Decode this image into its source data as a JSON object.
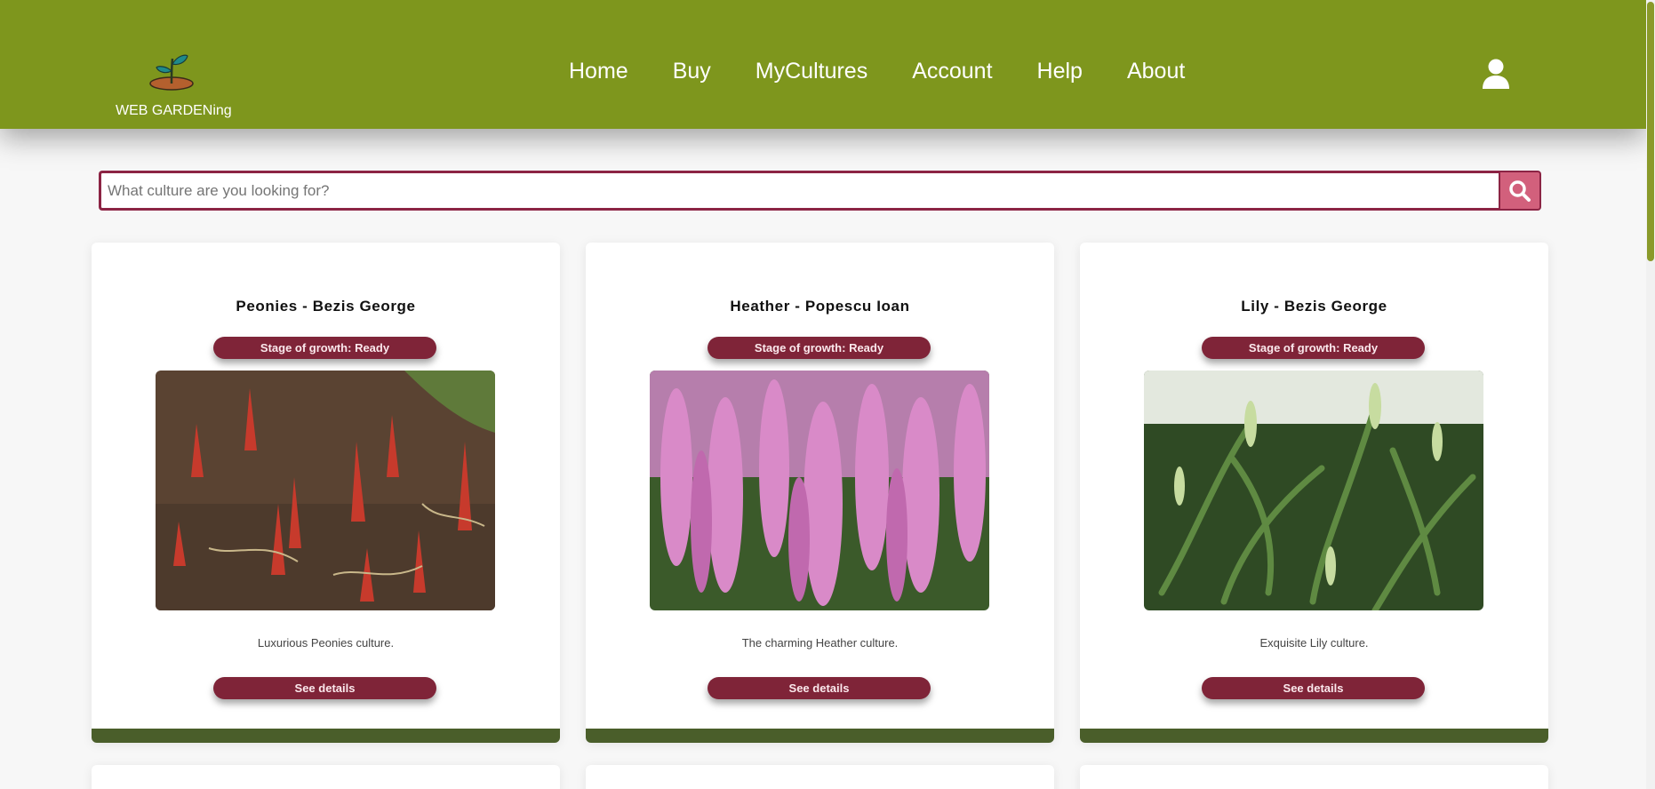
{
  "brand": {
    "name": "WEB GARDENing",
    "logo_icon": "sprout-icon"
  },
  "nav": [
    {
      "label": "Home"
    },
    {
      "label": "Buy"
    },
    {
      "label": "MyCultures"
    },
    {
      "label": "Account"
    },
    {
      "label": "Help"
    },
    {
      "label": "About"
    }
  ],
  "header": {
    "user_icon": "user-icon",
    "color": "#7e961d"
  },
  "search": {
    "placeholder": "What culture are you looking for?",
    "value": "",
    "button_icon": "search-icon"
  },
  "cards": [
    {
      "title": "Peonies - Bezis George",
      "stage": "Stage of growth: Ready",
      "description": "Luxurious Peonies culture.",
      "button": "See details",
      "image": "peony-shoots"
    },
    {
      "title": "Heather - Popescu Ioan",
      "stage": "Stage of growth: Ready",
      "description": "The charming Heather culture.",
      "button": "See details",
      "image": "heather-flowers"
    },
    {
      "title": "Lily - Bezis George",
      "stage": "Stage of growth: Ready",
      "description": "Exquisite Lily culture.",
      "button": "See details",
      "image": "lily-plants"
    }
  ],
  "colors": {
    "accent": "#7f2438",
    "card_bar": "#4a5e2a",
    "search_button": "#d2607c"
  }
}
